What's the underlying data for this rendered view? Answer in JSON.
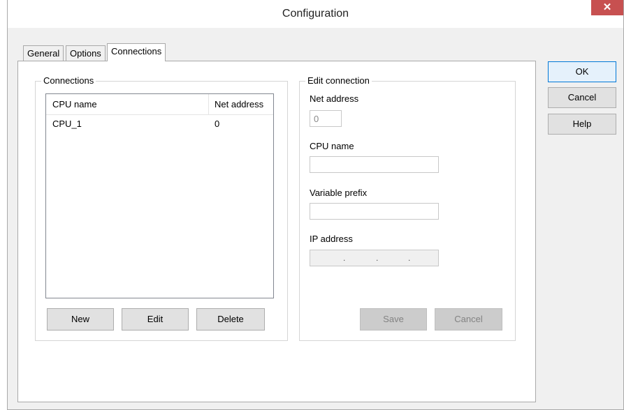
{
  "window": {
    "title": "Configuration",
    "close_glyph": "✕"
  },
  "tabs": [
    {
      "label": "General"
    },
    {
      "label": "Options"
    },
    {
      "label": "Connections"
    }
  ],
  "connections_group": {
    "label": "Connections",
    "columns": [
      "CPU name",
      "Net address"
    ],
    "rows": [
      {
        "cpu_name": "CPU_1",
        "net_address": "0"
      }
    ],
    "buttons": {
      "new": "New",
      "edit": "Edit",
      "delete": "Delete"
    }
  },
  "edit_group": {
    "label": "Edit connection",
    "net_address_label": "Net address",
    "net_address_value": "0",
    "cpu_name_label": "CPU name",
    "cpu_name_value": "",
    "variable_prefix_label": "Variable prefix",
    "variable_prefix_value": "",
    "ip_address_label": "IP address",
    "ip_dots": [
      ".",
      ".",
      "."
    ],
    "save": "Save",
    "cancel": "Cancel"
  },
  "dialog_buttons": {
    "ok": "OK",
    "cancel": "Cancel",
    "help": "Help"
  },
  "colors": {
    "close": "#c75050",
    "primary_border": "#0078d7"
  }
}
